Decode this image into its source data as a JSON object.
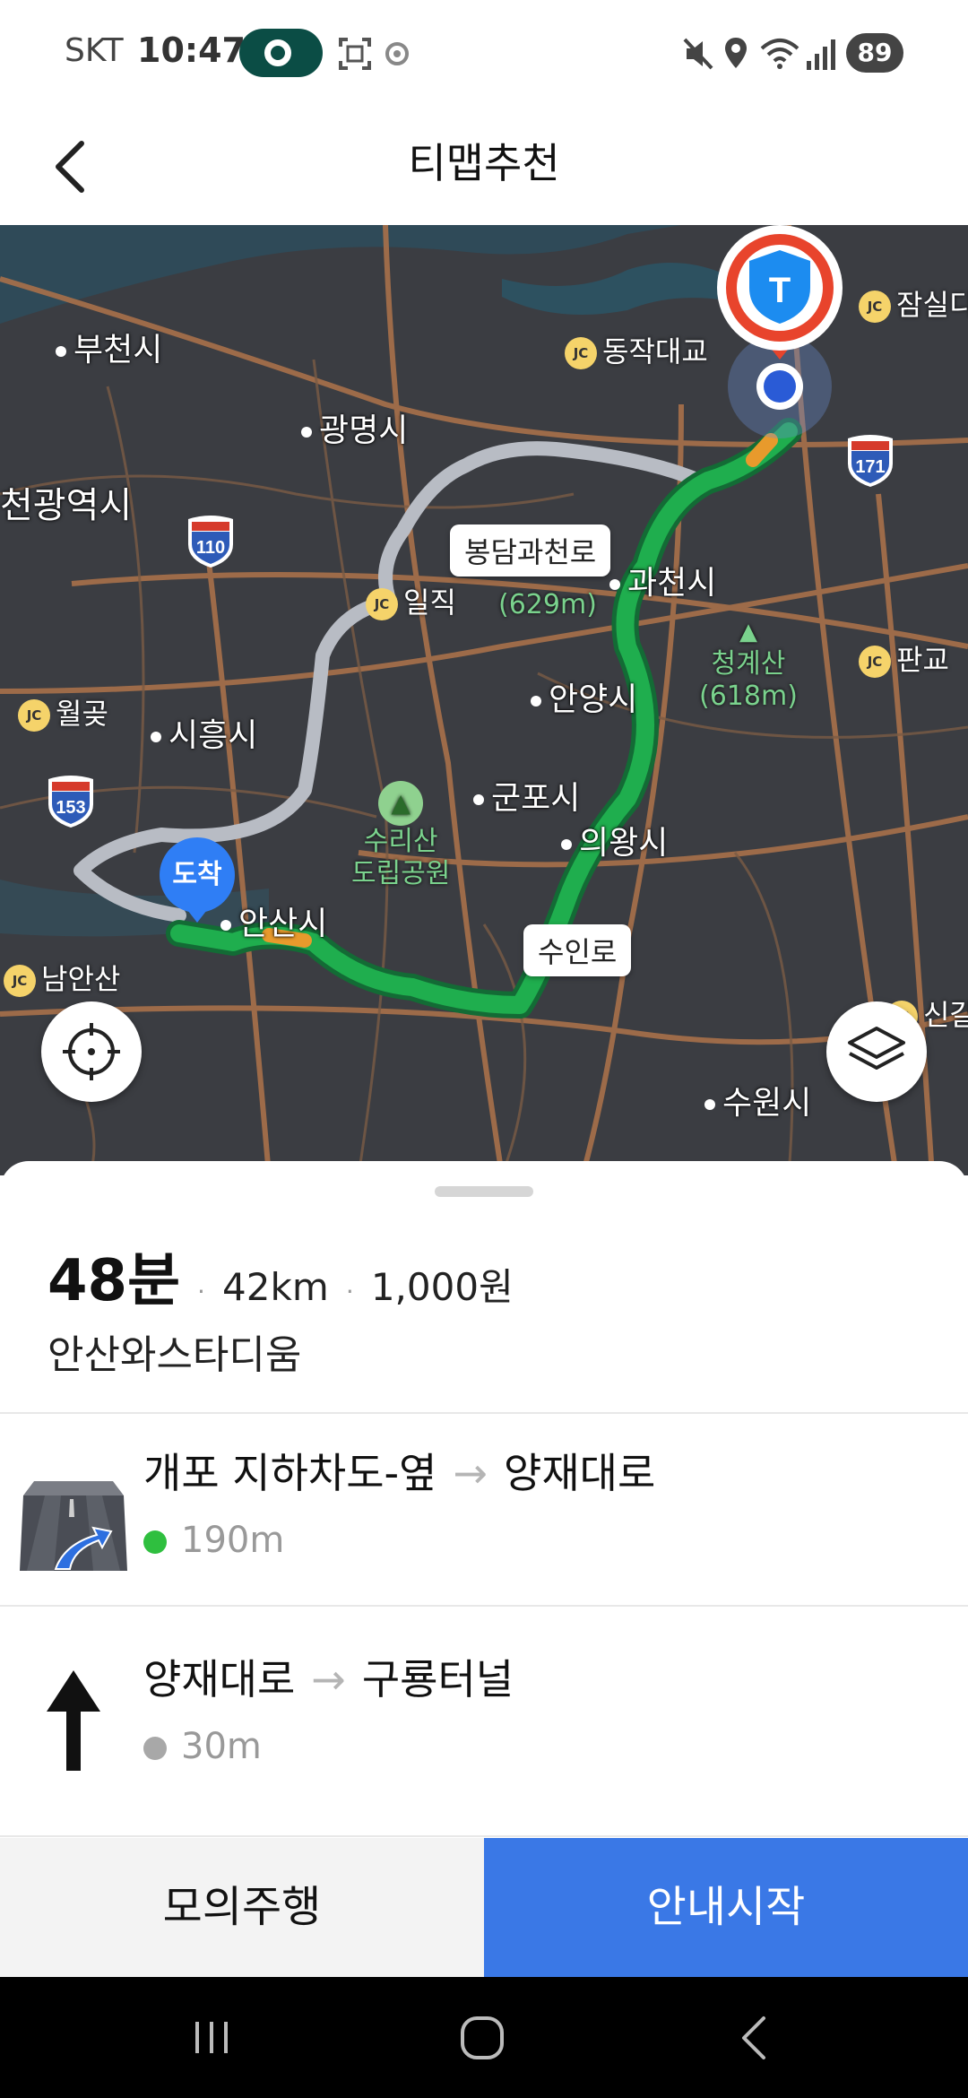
{
  "status_bar": {
    "carrier": "SKT",
    "time": "10:47",
    "battery": "89"
  },
  "header": {
    "title": "티맵추천"
  },
  "map": {
    "place_labels": {
      "bucheon": "부천시",
      "gwangmyeong": "광명시",
      "metro": "천광역시",
      "gwacheon": "과천시",
      "anyang": "안양시",
      "siheung": "시흥시",
      "gunpo": "군포시",
      "uiwang": "의왕시",
      "ansan": "안산시",
      "suwon": "수원시"
    },
    "jc_labels": {
      "dongjak": "동작대교",
      "jamsil": "잠실디",
      "iljik": "일직",
      "wolgot": "월곶",
      "pangyo": "판교",
      "namansan": "남안산",
      "singal": "신갈"
    },
    "mountains": {
      "gwanak": "(629m)",
      "cheonggye_name": "청계산",
      "cheonggye_height": "(618m)",
      "surisan_line1": "수리산",
      "surisan_line2": "도립공원"
    },
    "highways": [
      "171",
      "110",
      "153"
    ],
    "road_tags": {
      "bongdam": "봉담과천로",
      "suin": "수인로"
    },
    "arrival_marker": "도착",
    "colors": {
      "route_primary": "#1fae4e",
      "route_alt": "#b8bcc4",
      "origin_marker": "#e8442c"
    }
  },
  "route": {
    "duration": "48분",
    "distance": "42km",
    "toll": "1,000원",
    "destination": "안산와스타디움",
    "steps": [
      {
        "from": "개포 지하차도-옆",
        "arrow": "→",
        "to": "양재대로",
        "distance": "190m",
        "dot_color": "#2fbf3f"
      },
      {
        "from": "양재대로",
        "arrow": "→",
        "to": "구룡터널",
        "distance": "30m",
        "dot_color": "#a8a8a8"
      }
    ]
  },
  "buttons": {
    "simulate": "모의주행",
    "start": "안내시작"
  }
}
